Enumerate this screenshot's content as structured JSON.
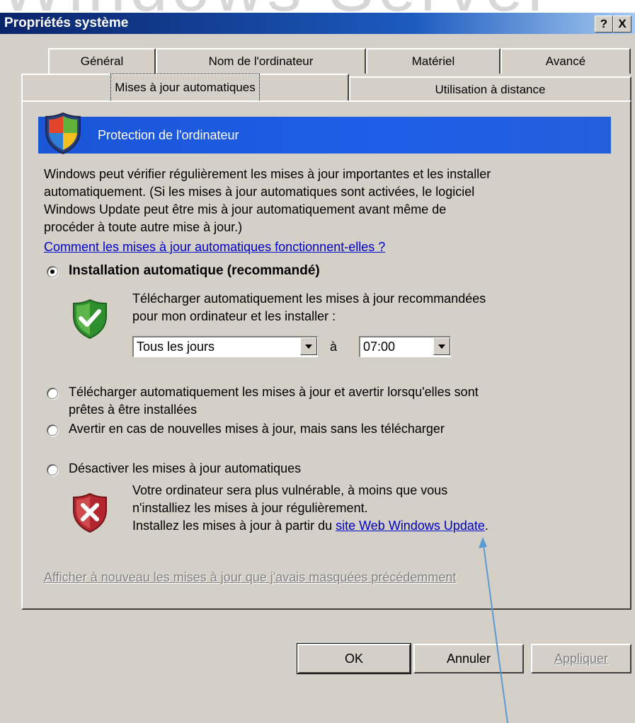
{
  "background_text": "Windows Server",
  "window": {
    "title": "Propriétés système",
    "help_button": "?",
    "close_button": "X"
  },
  "tabs_row1": [
    "Général",
    "Nom de l'ordinateur",
    "Matériel",
    "Avancé"
  ],
  "tabs_row2": [
    "Mises à jour automatiques",
    "Utilisation à distance"
  ],
  "active_tab": "Mises à jour automatiques",
  "banner": {
    "title": "Protection de l'ordinateur",
    "icon": "security-shield-icon"
  },
  "description": {
    "lines": [
      "Windows peut vérifier régulièrement les mises à jour importantes et les installer",
      "automatiquement. (Si les mises à jour automatiques sont activées, le logiciel",
      "Windows Update peut être mis à jour automatiquement avant même de",
      "procéder à toute autre mise à jour.)"
    ],
    "help_link": "Comment les mises à jour automatiques fonctionnent-elles ?"
  },
  "options": {
    "auto_install": {
      "label": "Installation automatique (recommandé)",
      "selected": true,
      "desc_lines": [
        "Télécharger automatiquement les mises à jour recommandées",
        "pour mon ordinateur et les installer :"
      ],
      "day_select": "Tous les jours",
      "at_label": "à",
      "time_select": "07:00"
    },
    "download_notify": {
      "label_lines": [
        "Télécharger automatiquement les mises à jour et avertir lorsqu'elles sont",
        "prêtes à être installées"
      ],
      "selected": false
    },
    "notify_only": {
      "label": "Avertir en cas de nouvelles mises à jour, mais sans les télécharger",
      "selected": false
    },
    "disable": {
      "label": "Désactiver les mises à jour automatiques",
      "selected": false,
      "warning_lines": [
        "Votre ordinateur sera plus vulnérable, à moins que vous",
        "n'installiez les mises à jour régulièrement."
      ],
      "install_prefix": "Installez les mises à jour à partir du ",
      "install_link": "site Web Windows Update",
      "install_suffix": "."
    }
  },
  "hidden_updates_link": "Afficher à nouveau les mises à jour que j'avais masquées précédemment",
  "buttons": {
    "ok": "OK",
    "cancel": "Annuler",
    "apply": "Appliquer"
  },
  "colors": {
    "dialog_bg": "#d4d0c8",
    "title_bar": "#0a246a",
    "banner": "#1e5fe8",
    "link": "#0000cc",
    "annotation_arrow": "#5b9bd5"
  }
}
